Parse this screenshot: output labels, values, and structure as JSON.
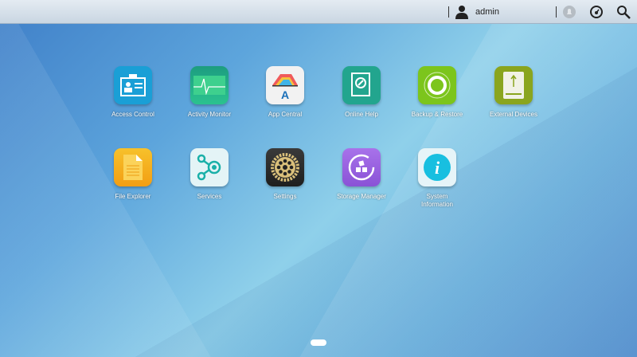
{
  "topbar": {
    "username": "admin",
    "icons": [
      "user-icon",
      "notification-icon",
      "dashboard-icon",
      "search-icon"
    ]
  },
  "apps": [
    {
      "label": "Access Control",
      "color": "#1a9fd6"
    },
    {
      "label": "Activity Monitor",
      "color": "#1aa88a"
    },
    {
      "label": "App Central",
      "color": "#f2f2f2"
    },
    {
      "label": "Online Help",
      "color": "#22a58e"
    },
    {
      "label": "Backup & Restore",
      "color": "#7cc51c"
    },
    {
      "label": "External Devices",
      "color": "#8aa51e"
    },
    {
      "label": "File Explorer",
      "color": "#f5b21c"
    },
    {
      "label": "Services",
      "color": "#e4f4f6"
    },
    {
      "label": "Settings",
      "color": "#2b2b2b"
    },
    {
      "label": "Storage Manager",
      "color": "#9a63e0"
    },
    {
      "label": "System Information",
      "color": "#e6f4f8"
    }
  ],
  "pager": {
    "current_page": 1
  }
}
